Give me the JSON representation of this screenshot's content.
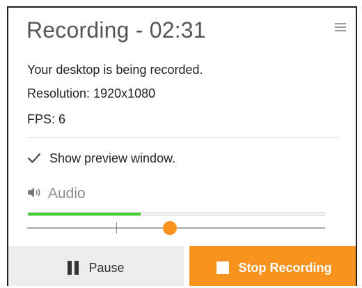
{
  "recorder": {
    "title": "Recording - 02:31",
    "status": "Your desktop is being recorded.",
    "resolution": "Resolution: 1920x1080",
    "fps": "FPS: 6",
    "menu_icon": "hamburger-menu-icon"
  },
  "preview": {
    "label": "Show preview window.",
    "checked": true,
    "icon": "checkmark-icon"
  },
  "audio": {
    "label": "Audio",
    "icon": "speaker-icon",
    "level": 0.38,
    "volume": 0.48,
    "default_volume": 0.3
  },
  "controls": {
    "pause_label": "Pause",
    "stop_label": "Stop Recording",
    "pause_icon": "pause-icon",
    "stop_icon": "stop-icon"
  },
  "colors": {
    "accent": "#f7931e",
    "meter": "#3fd12f",
    "pause_bg": "#ededed"
  }
}
